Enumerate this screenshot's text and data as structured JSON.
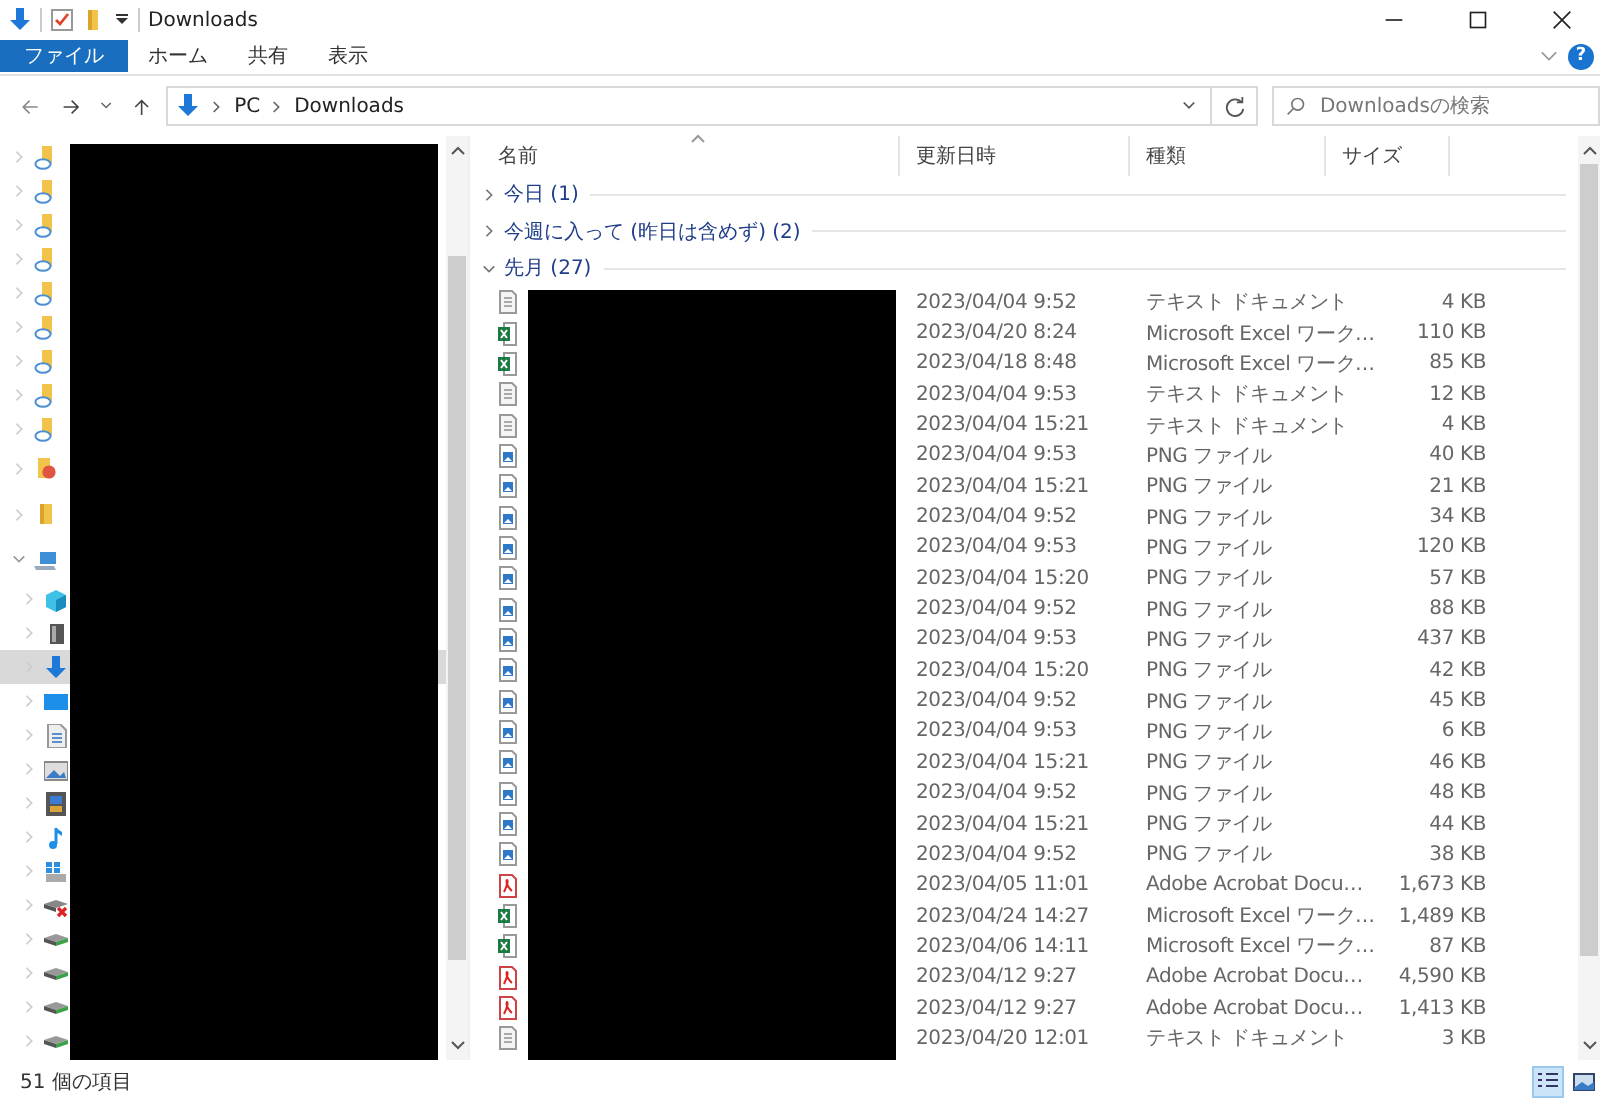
{
  "window": {
    "title": "Downloads"
  },
  "ribbon": {
    "tabs": [
      {
        "label": "ファイル",
        "selected": true
      },
      {
        "label": "ホーム",
        "selected": false
      },
      {
        "label": "共有",
        "selected": false
      },
      {
        "label": "表示",
        "selected": false
      }
    ],
    "help": "?"
  },
  "address": {
    "crumbs": [
      "PC",
      "Downloads"
    ],
    "search_placeholder": "Downloadsの検索"
  },
  "sidebar": {
    "items": [
      {
        "kind": "cloud-folder",
        "selected": false
      },
      {
        "kind": "cloud-folder",
        "selected": false
      },
      {
        "kind": "cloud-folder",
        "selected": false
      },
      {
        "kind": "cloud-folder",
        "selected": false
      },
      {
        "kind": "cloud-folder",
        "selected": false
      },
      {
        "kind": "cloud-folder",
        "selected": false
      },
      {
        "kind": "cloud-folder",
        "selected": false
      },
      {
        "kind": "cloud-folder",
        "selected": false
      },
      {
        "kind": "cloud-folder",
        "selected": false
      },
      {
        "kind": "badge-folder",
        "selected": false
      },
      {
        "kind": "folder",
        "selected": false
      },
      {
        "kind": "pc",
        "selected": false,
        "expanded": true,
        "children": [
          {
            "kind": "objects3d",
            "selected": false
          },
          {
            "kind": "drive",
            "selected": false
          },
          {
            "kind": "downloads",
            "selected": true
          },
          {
            "kind": "desktop",
            "selected": false
          },
          {
            "kind": "document",
            "selected": false
          },
          {
            "kind": "pictures",
            "selected": false
          },
          {
            "kind": "videos",
            "selected": false
          },
          {
            "kind": "music",
            "selected": false
          },
          {
            "kind": "windows-drive",
            "selected": false
          },
          {
            "kind": "network-drive-error",
            "selected": false
          },
          {
            "kind": "network-drive",
            "selected": false
          },
          {
            "kind": "network-drive",
            "selected": false
          },
          {
            "kind": "network-drive",
            "selected": false
          },
          {
            "kind": "network-drive",
            "selected": false
          }
        ]
      }
    ]
  },
  "file_list": {
    "columns": [
      "名前",
      "更新日時",
      "種類",
      "サイズ"
    ],
    "groups": [
      {
        "label": "今日 (1)",
        "expanded": false
      },
      {
        "label": "今週に入って (昨日は含めず) (2)",
        "expanded": false
      },
      {
        "label": "先月 (27)",
        "expanded": true,
        "rows": [
          {
            "kind": "text",
            "date": "2023/04/04 9:52",
            "type": "テキスト ドキュメント",
            "size": "4 KB"
          },
          {
            "kind": "excel",
            "date": "2023/04/20 8:24",
            "type": "Microsoft Excel ワーク…",
            "size": "110 KB"
          },
          {
            "kind": "excel",
            "date": "2023/04/18 8:48",
            "type": "Microsoft Excel ワーク…",
            "size": "85 KB"
          },
          {
            "kind": "text",
            "date": "2023/04/04 9:53",
            "type": "テキスト ドキュメント",
            "size": "12 KB"
          },
          {
            "kind": "text",
            "date": "2023/04/04 15:21",
            "type": "テキスト ドキュメント",
            "size": "4 KB"
          },
          {
            "kind": "png",
            "date": "2023/04/04 9:53",
            "type": "PNG ファイル",
            "size": "40 KB"
          },
          {
            "kind": "png",
            "date": "2023/04/04 15:21",
            "type": "PNG ファイル",
            "size": "21 KB"
          },
          {
            "kind": "png",
            "date": "2023/04/04 9:52",
            "type": "PNG ファイル",
            "size": "34 KB"
          },
          {
            "kind": "png",
            "date": "2023/04/04 9:53",
            "type": "PNG ファイル",
            "size": "120 KB"
          },
          {
            "kind": "png",
            "date": "2023/04/04 15:20",
            "type": "PNG ファイル",
            "size": "57 KB"
          },
          {
            "kind": "png",
            "date": "2023/04/04 9:52",
            "type": "PNG ファイル",
            "size": "88 KB"
          },
          {
            "kind": "png",
            "date": "2023/04/04 9:53",
            "type": "PNG ファイル",
            "size": "437 KB"
          },
          {
            "kind": "png",
            "date": "2023/04/04 15:20",
            "type": "PNG ファイル",
            "size": "42 KB"
          },
          {
            "kind": "png",
            "date": "2023/04/04 9:52",
            "type": "PNG ファイル",
            "size": "45 KB"
          },
          {
            "kind": "png",
            "date": "2023/04/04 9:53",
            "type": "PNG ファイル",
            "size": "6 KB"
          },
          {
            "kind": "png",
            "date": "2023/04/04 15:21",
            "type": "PNG ファイル",
            "size": "46 KB"
          },
          {
            "kind": "png",
            "date": "2023/04/04 9:52",
            "type": "PNG ファイル",
            "size": "48 KB"
          },
          {
            "kind": "png",
            "date": "2023/04/04 15:21",
            "type": "PNG ファイル",
            "size": "44 KB"
          },
          {
            "kind": "png",
            "date": "2023/04/04 9:52",
            "type": "PNG ファイル",
            "size": "38 KB"
          },
          {
            "kind": "pdf",
            "date": "2023/04/05 11:01",
            "type": "Adobe Acrobat Docu…",
            "size": "1,673 KB"
          },
          {
            "kind": "excel",
            "date": "2023/04/24 14:27",
            "type": "Microsoft Excel ワーク…",
            "size": "1,489 KB"
          },
          {
            "kind": "excel",
            "date": "2023/04/06 14:11",
            "type": "Microsoft Excel ワーク…",
            "size": "87 KB"
          },
          {
            "kind": "pdf",
            "date": "2023/04/12 9:27",
            "type": "Adobe Acrobat Docu…",
            "size": "4,590 KB"
          },
          {
            "kind": "pdf",
            "date": "2023/04/12 9:27",
            "type": "Adobe Acrobat Docu…",
            "size": "1,413 KB"
          },
          {
            "kind": "text",
            "date": "2023/04/20 12:01",
            "type": "テキスト ドキュメント",
            "size": "3 KB"
          }
        ]
      }
    ]
  },
  "status_bar": {
    "count": "51 個の項目",
    "views": [
      {
        "kind": "details",
        "selected": true
      },
      {
        "kind": "large-icons",
        "selected": false
      }
    ]
  }
}
